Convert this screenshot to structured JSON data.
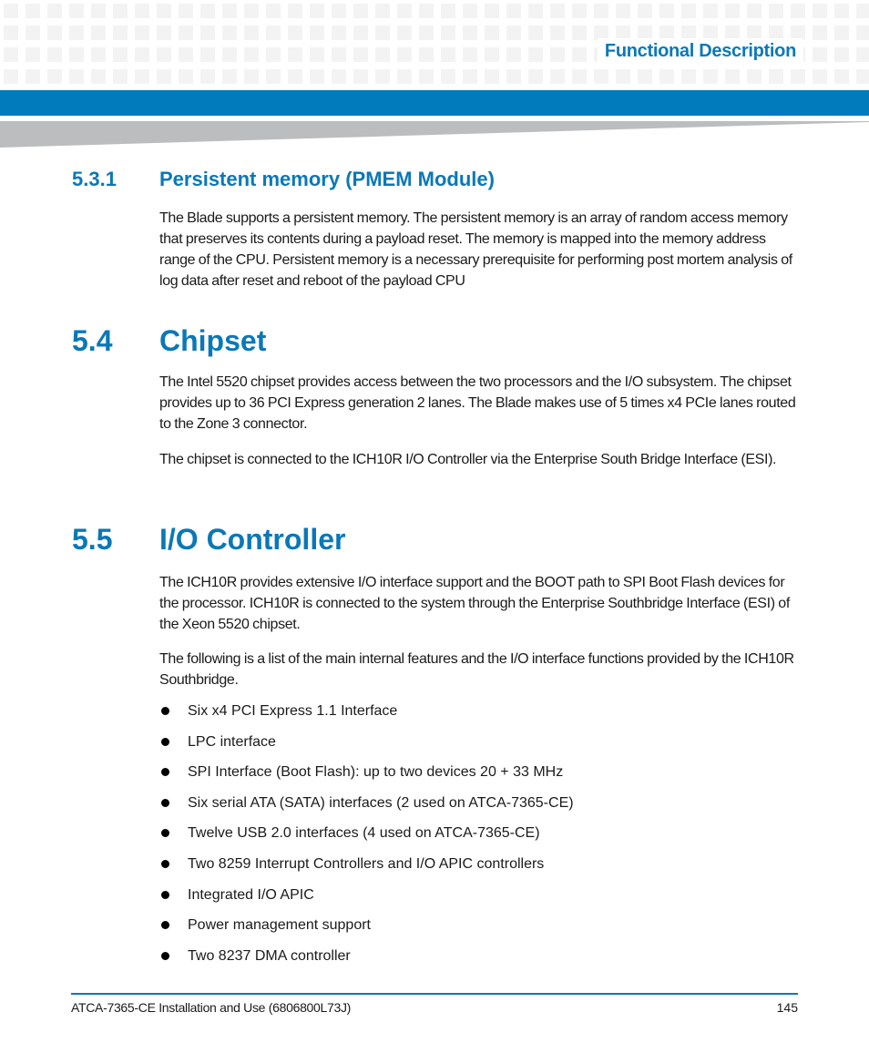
{
  "header": {
    "chapter_title": "Functional Description",
    "accent_color": "#017bbc",
    "heading_color": "#0a78b8"
  },
  "sections": [
    {
      "number": "5.3.1",
      "title": "Persistent memory (PMEM Module)",
      "paragraphs": [
        "The Blade supports a persistent memory. The persistent memory is an array of random access memory that preserves its contents during a payload reset. The memory is mapped into the memory address range of the CPU. Persistent memory is a necessary prerequisite for performing post mortem analysis of log data after reset and reboot of the payload CPU"
      ]
    },
    {
      "number": "5.4",
      "title": "Chipset",
      "paragraphs": [
        "The Intel 5520 chipset provides access between the two processors and the I/O subsystem. The chipset provides up to 36 PCI Express generation 2 lanes. The Blade makes use of 5 times x4 PCIe lanes routed to the Zone 3 connector.",
        "The chipset is connected to the ICH10R I/O Controller via the Enterprise South Bridge Interface (ESI)."
      ]
    },
    {
      "number": "5.5",
      "title": "I/O Controller",
      "paragraphs": [
        "The ICH10R provides extensive I/O interface support and the BOOT path to SPI Boot Flash devices for the processor. ICH10R is connected to the system through the Enterprise Southbridge Interface (ESI) of the Xeon 5520 chipset.",
        "The following is a list of the main internal features and the I/O interface functions provided by the ICH10R Southbridge."
      ],
      "bullets": [
        "Six x4 PCI Express 1.1 Interface",
        "LPC interface",
        "SPI Interface (Boot Flash): up to two devices 20 + 33 MHz",
        "Six serial ATA (SATA) interfaces (2 used on ATCA-7365-CE)",
        "Twelve USB 2.0 interfaces (4 used on ATCA-7365-CE)",
        "Two 8259 Interrupt Controllers and I/O APIC controllers",
        "Integrated I/O APIC",
        "Power management support",
        "Two 8237 DMA controller"
      ]
    }
  ],
  "footer": {
    "document_title": "ATCA-7365-CE Installation and Use (6806800L73J)",
    "page_number": "145"
  }
}
